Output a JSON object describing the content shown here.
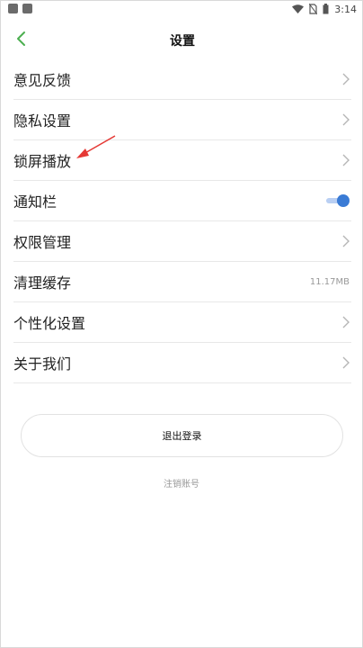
{
  "status_bar": {
    "time": "3:14",
    "icons": [
      "wifi-icon",
      "no-sim-icon",
      "battery-icon"
    ]
  },
  "header": {
    "title": "设置"
  },
  "settings": {
    "items": [
      {
        "label": "意见反馈"
      },
      {
        "label": "隐私设置"
      },
      {
        "label": "锁屏播放"
      },
      {
        "label": "通知栏"
      },
      {
        "label": "权限管理"
      },
      {
        "label": "清理缓存",
        "value": "11.17MB"
      },
      {
        "label": "个性化设置"
      },
      {
        "label": "关于我们"
      }
    ],
    "notification_toggle_on": true
  },
  "actions": {
    "logout_label": "退出登录",
    "cancel_account_label": "注销账号"
  },
  "colors": {
    "accent": "#3a7bd5",
    "back_arrow": "#4caf50",
    "annotation_arrow": "#e53935"
  }
}
